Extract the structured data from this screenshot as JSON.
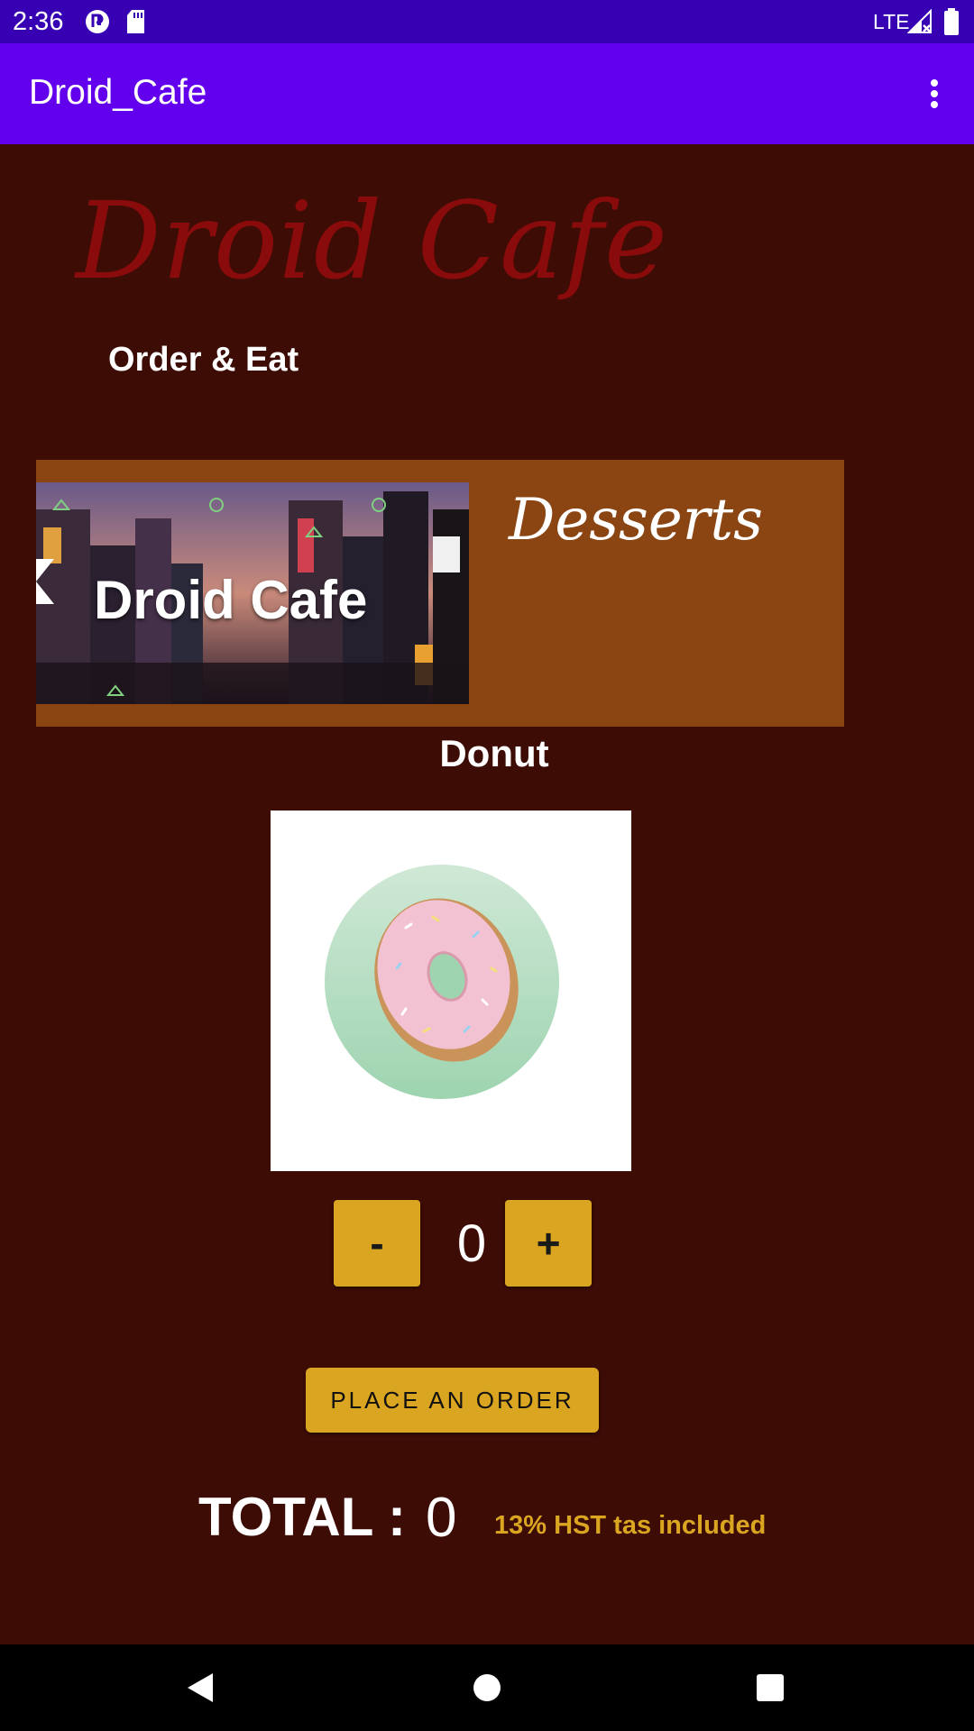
{
  "status_bar": {
    "time": "2:36",
    "network": "LTE",
    "icons": [
      "notification-app-icon",
      "sd-card-icon",
      "signal-icon",
      "battery-icon"
    ]
  },
  "app_bar": {
    "title": "Droid_Cafe",
    "menu_icon": "more-vert-icon"
  },
  "header": {
    "brand": "Droid Cafe",
    "tagline": "Order & Eat"
  },
  "category": {
    "banner_text": "Droid Cafe",
    "title": "Desserts"
  },
  "item": {
    "name": "Donut",
    "image": "donut-image"
  },
  "quantity": {
    "decrement_label": "-",
    "value": "0",
    "increment_label": "+"
  },
  "order_button": "PLACE AN ORDER",
  "total": {
    "label": "TOTAL :",
    "value": "0",
    "tax_note": "13% HST tas included"
  },
  "colors": {
    "background": "#3c0c05",
    "status_bar": "#3700b3",
    "app_bar": "#6200ee",
    "card": "#8b4513",
    "accent": "#daa520",
    "brand": "#8a0b0b"
  }
}
